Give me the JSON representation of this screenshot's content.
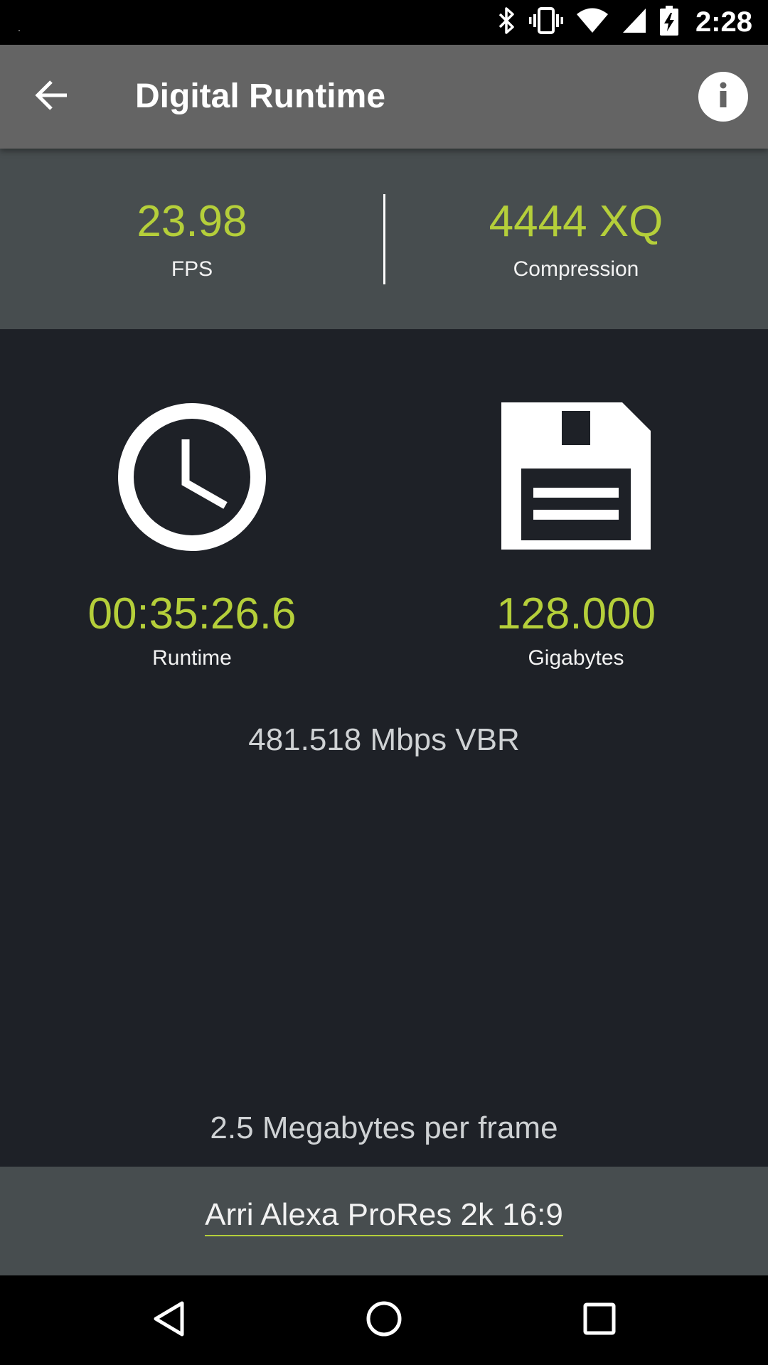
{
  "status_bar": {
    "time": "2:28",
    "icons": [
      "bluetooth-icon",
      "vibrate-icon",
      "wifi-icon",
      "signal-icon",
      "battery-charging-icon"
    ]
  },
  "app_bar": {
    "title": "Digital Runtime",
    "back_icon": "arrow-back-icon",
    "info_icon": "info-icon"
  },
  "stats": {
    "fps": {
      "value": "23.98",
      "label": "FPS"
    },
    "compression": {
      "value": "4444 XQ",
      "label": "Compression"
    }
  },
  "metrics": {
    "runtime": {
      "icon": "clock-icon",
      "value": "00:35:26.6",
      "label": "Runtime"
    },
    "storage": {
      "icon": "floppy-disk-icon",
      "value": "128.000",
      "label": "Gigabytes"
    }
  },
  "bitrate": "481.518 Mbps VBR",
  "per_frame": "2.5 Megabytes per frame",
  "preset": "Arri Alexa ProRes 2k 16:9",
  "colors": {
    "accent": "#b5cf3a",
    "app_bar": "#646464",
    "header": "#474d4f",
    "main": "#1e2127"
  },
  "nav_bar": {
    "icons": [
      "back-triangle-icon",
      "home-circle-icon",
      "recents-square-icon"
    ]
  }
}
